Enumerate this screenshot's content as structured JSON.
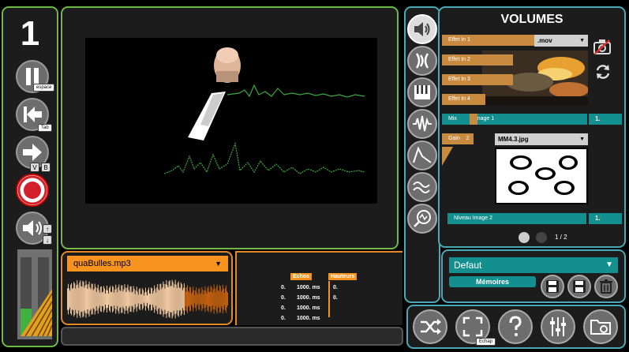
{
  "scene": {
    "number": "1"
  },
  "transport": {
    "pause_key": "espace",
    "prev_key": "Tab",
    "next_key_v": "V",
    "next_key_b": "B",
    "volume_up_key": "↑",
    "volume_down_key": "↓"
  },
  "meters": {
    "left_level": 0.35,
    "right_level": 0.05
  },
  "audio": {
    "file": "quaBulles.mp3",
    "progress": 0.73
  },
  "echos": {
    "header_echos": "Echos",
    "header_hauteurs": "Hauteurs",
    "rows": [
      {
        "a": "0.",
        "ms": "1000. ms",
        "h": "0."
      },
      {
        "a": "0.",
        "ms": "1000. ms",
        "h": "0."
      },
      {
        "a": "0.",
        "ms": "1000. ms",
        "h": ""
      },
      {
        "a": "0.",
        "ms": "1000. ms",
        "h": ""
      }
    ]
  },
  "volumes": {
    "title": "VOLUMES",
    "effects": [
      "Effet In 1",
      "Effet In 2",
      "Effet In 3",
      "Effet In 4"
    ],
    "video_file": ".mov",
    "mix_label": "Mix",
    "mix_image_label": "Image 1",
    "mix_value": "1.",
    "gain_label": "Gain",
    "gain_suffix": "2",
    "image_file": "MM4.3.jpg",
    "niveau_label": "Niveau Image 2",
    "niveau_value": "1.",
    "page": "1 / 2"
  },
  "memories": {
    "preset": "Defaut",
    "button": "Mémoires"
  },
  "bottom": {
    "fullscreen_key": "Echap"
  },
  "colors": {
    "green": "#6fb84a",
    "orange": "#f7931e",
    "teal": "#148f8f"
  }
}
